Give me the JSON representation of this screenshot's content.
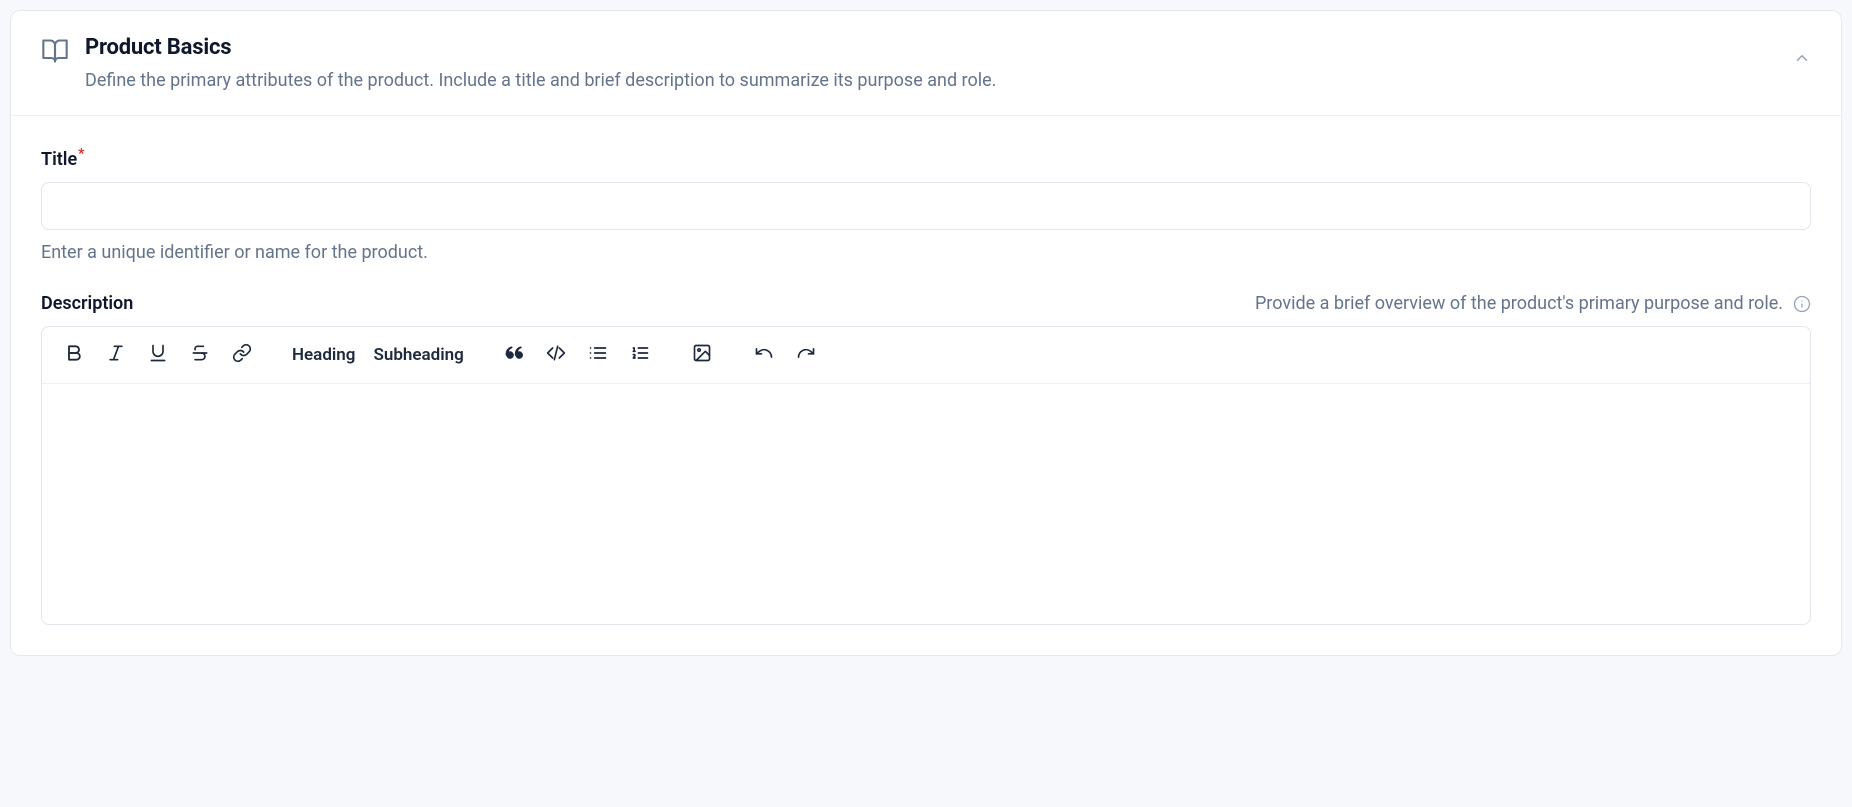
{
  "section": {
    "title": "Product Basics",
    "subtitle": "Define the primary attributes of the product. Include a title and brief description to summarize its purpose and role."
  },
  "fields": {
    "title": {
      "label": "Title",
      "required_marker": "*",
      "value": "",
      "help": "Enter a unique identifier or name for the product."
    },
    "description": {
      "label": "Description",
      "hint": "Provide a brief overview of the product's primary purpose and role.",
      "value": ""
    }
  },
  "toolbar": {
    "heading": "Heading",
    "subheading": "Subheading"
  }
}
